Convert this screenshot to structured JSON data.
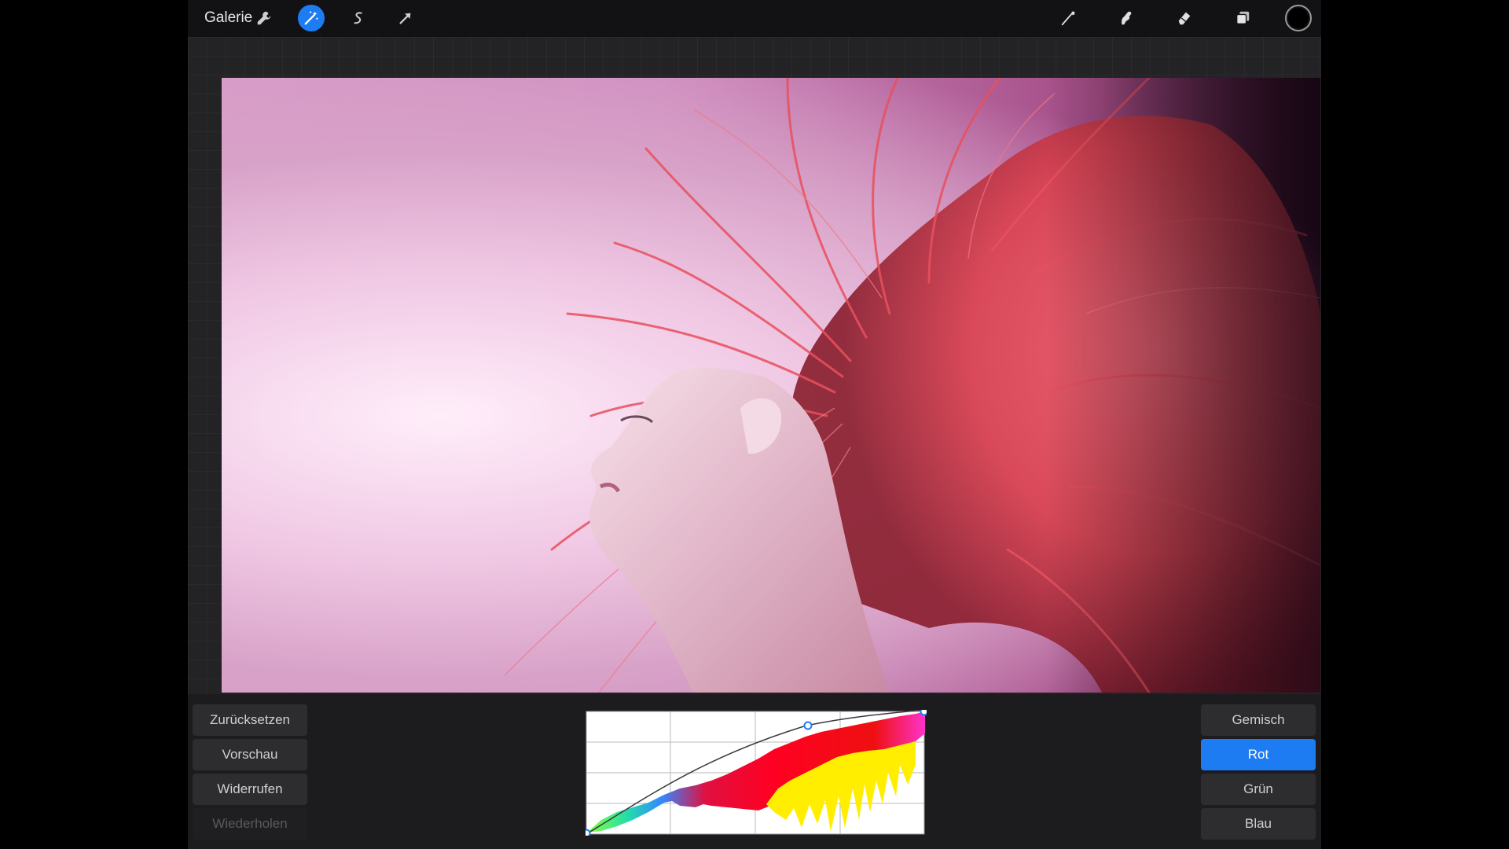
{
  "toolbar": {
    "gallery_label": "Galerie",
    "left_icons": [
      "wrench-icon",
      "magic-wand-icon",
      "selection-icon",
      "transform-arrow-icon"
    ],
    "right_icons": [
      "brush-icon",
      "smudge-icon",
      "eraser-icon",
      "layers-icon",
      "color-swatch-icon"
    ],
    "accent_color": "#1e7cf2",
    "current_color": "#000000"
  },
  "curves": {
    "actions": [
      {
        "label": "Zurücksetzen",
        "enabled": true
      },
      {
        "label": "Vorschau",
        "enabled": true
      },
      {
        "label": "Widerrufen",
        "enabled": true
      },
      {
        "label": "Wiederholen",
        "enabled": false
      }
    ],
    "channels": [
      {
        "label": "Gemisch",
        "selected": false
      },
      {
        "label": "Rot",
        "selected": true
      },
      {
        "label": "Grün",
        "selected": false
      },
      {
        "label": "Blau",
        "selected": false
      }
    ],
    "control_points": [
      [
        0,
        0
      ],
      [
        0.66,
        0.88
      ],
      [
        1,
        1
      ]
    ]
  }
}
